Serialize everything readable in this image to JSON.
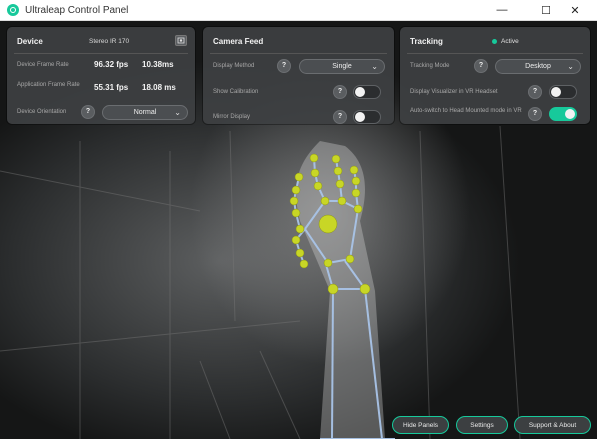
{
  "window": {
    "title": "Ultraleap Control Panel",
    "minimize_label": "—",
    "maximize_label": "☐",
    "close_label": "✕"
  },
  "device": {
    "title": "Device",
    "device_name": "Stereo IR 170",
    "frame_rate_label": "Device Frame Rate",
    "frame_rate_fps": "96.32 fps",
    "frame_rate_ms": "10.38ms",
    "app_frame_rate_label": "Application Frame Rate",
    "app_frame_rate_fps": "55.31 fps",
    "app_frame_rate_ms": "18.08 ms",
    "orientation_label": "Device Orientation",
    "orientation_value": "Normal"
  },
  "camera_feed": {
    "title": "Camera Feed",
    "display_method_label": "Display Method",
    "display_method_value": "Single",
    "show_calibration_label": "Show Calibration",
    "show_calibration_on": false,
    "mirror_display_label": "Mirror Display",
    "mirror_display_on": false
  },
  "tracking": {
    "title": "Tracking",
    "status": "Active",
    "mode_label": "Tracking Mode",
    "mode_value": "Desktop",
    "display_viz_label": "Display Visualizer in VR Headset",
    "display_viz_on": false,
    "auto_switch_label": "Auto-switch to Head Mounted mode in VR",
    "auto_switch_on": true
  },
  "help_glyph": "?",
  "chevron_glyph": "⌄",
  "footer": {
    "hide_panels": "Hide Panels",
    "settings": "Settings",
    "support": "Support & About"
  },
  "colors": {
    "accent": "#17c99b",
    "panel": "#3e4042",
    "joint": "#c8d626",
    "bone": "#a9c4e8"
  },
  "icons": {
    "app_logo": "ultraleap-logo-icon",
    "camera_settings": "camera-settings-icon"
  }
}
